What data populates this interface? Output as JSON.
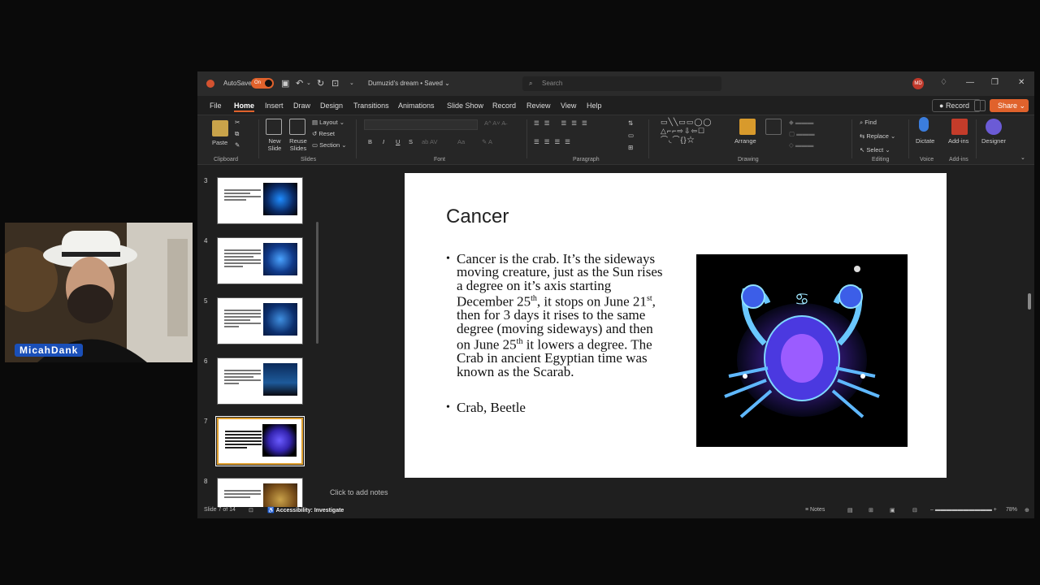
{
  "window": {
    "autosave_label": "AutoSave",
    "autosave_state": "On",
    "file_title": "Dumuzid's dream • Saved ⌄",
    "search_placeholder": "Search",
    "avatar_initials": "MD"
  },
  "menu": {
    "tabs": [
      "File",
      "Home",
      "Insert",
      "Draw",
      "Design",
      "Transitions",
      "Animations",
      "Slide Show",
      "Record",
      "Review",
      "View",
      "Help"
    ],
    "record_button": "Record",
    "share_button": "Share"
  },
  "ribbon": {
    "clipboard": {
      "paste": "Paste",
      "group": "Clipboard"
    },
    "slides": {
      "new_slide": "New Slide",
      "reuse_slides": "Reuse Slides",
      "layout": "Layout",
      "reset": "Reset",
      "section": "Section",
      "group": "Slides"
    },
    "font": {
      "group": "Font"
    },
    "paragraph": {
      "group": "Paragraph"
    },
    "drawing": {
      "arrange": "Arrange",
      "group": "Drawing"
    },
    "editing": {
      "find": "Find",
      "replace": "Replace",
      "select": "Select",
      "group": "Editing"
    },
    "voice": {
      "dictate": "Dictate",
      "group": "Voice"
    },
    "addins": {
      "addins": "Add-ins",
      "group": "Add-ins"
    },
    "designer": {
      "label": "Designer"
    }
  },
  "thumbnails": [
    {
      "number": "3"
    },
    {
      "number": "4"
    },
    {
      "number": "5"
    },
    {
      "number": "6"
    },
    {
      "number": "7"
    },
    {
      "number": "8"
    }
  ],
  "slide": {
    "title": "Cancer",
    "bullet1_parts": {
      "a": "Cancer is the crab. It’s the sideways moving creature, just as the Sun rises a degree on it’s axis starting December 25",
      "sup1": "th",
      "b": ", it stops on June 21",
      "sup2": "st",
      "c": ", then for 3 days it rises to the same degree (moving sideways) and then on June 25",
      "sup3": "th",
      "d": " it lowers a degree. The Crab in ancient Egyptian time was known as the Scarab."
    },
    "bullet2": "Crab, Beetle"
  },
  "notes_placeholder": "Click to add notes",
  "status": {
    "slide_counter": "Slide 7 of 14",
    "accessibility": "Accessibility: Investigate",
    "notes": "Notes",
    "zoom": "78%"
  },
  "webcam": {
    "name": "MicahDank"
  },
  "colors": {
    "accent": "#e0622c",
    "ribbon_bg": "#262626",
    "app_bg": "#1f1f1f",
    "name_badge": "#1a4fb8"
  }
}
